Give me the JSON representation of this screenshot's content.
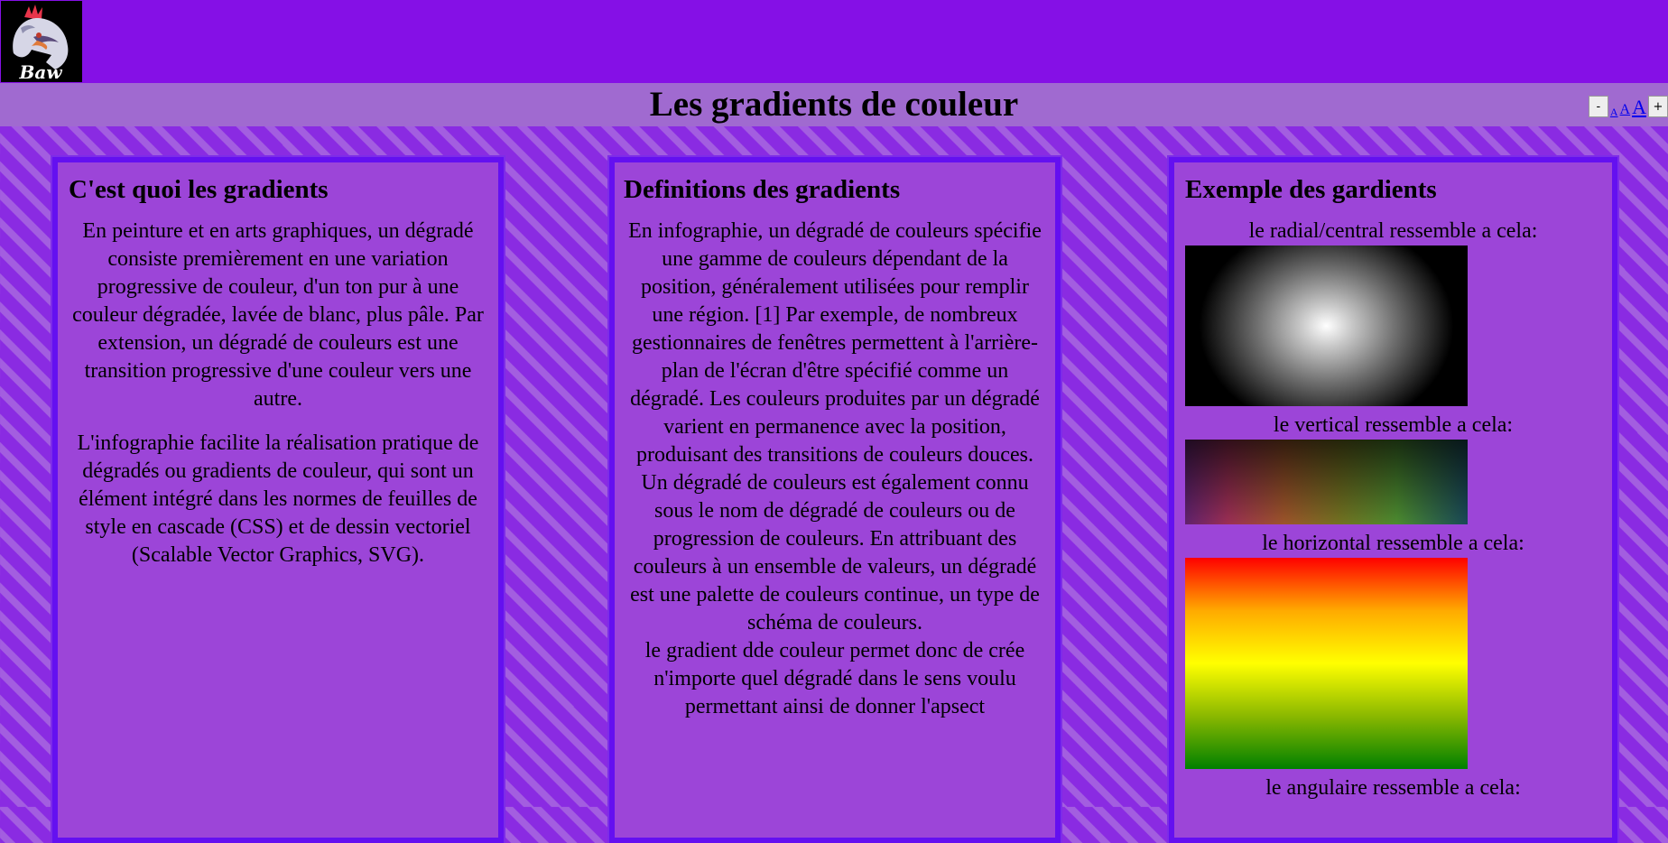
{
  "header": {
    "logo_text": "Baw",
    "title": "Les gradients de couleur",
    "font_controls": {
      "decrease": "-",
      "small_a": "A",
      "medium_a": "A",
      "large_a": "A",
      "increase": "+"
    }
  },
  "columns": [
    {
      "heading": "C'est quoi les gradients",
      "paragraphs": [
        "En peinture et en arts graphiques, un dégradé consiste premièrement en une variation progressive de couleur, d'un ton pur à une couleur dégradée, lavée de blanc, plus pâle. Par extension, un dégradé de couleurs est une transition progressive d'une couleur vers une autre.",
        "L'infographie facilite la réalisation pratique de dégradés ou gradients de couleur, qui sont un élément intégré dans les normes de feuilles de style en cascade (CSS) et de dessin vectoriel (Scalable Vector Graphics, SVG)."
      ]
    },
    {
      "heading": "Definitions des gradients",
      "paragraphs": [
        "En infographie, un dégradé de couleurs spécifie une gamme de couleurs dépendant de la position, généralement utilisées pour remplir une région. [1] Par exemple, de nombreux gestionnaires de fenêtres permettent à l'arrière-plan de l'écran d'être spécifié comme un dégradé. Les couleurs produites par un dégradé varient en permanence avec la position, produisant des transitions de couleurs douces.",
        "Un dégradé de couleurs est également connu sous le nom de dégradé de couleurs ou de progression de couleurs. En attribuant des couleurs à un ensemble de valeurs, un dégradé est une palette de couleurs continue, un type de schéma de couleurs.",
        "le gradient dde couleur permet donc de crée n'importe quel dégradé dans le sens voulu permettant ainsi de donner l'apsect"
      ]
    },
    {
      "heading": "Exemple des gardients",
      "examples": [
        {
          "label": "le radial/central ressemble a cela:"
        },
        {
          "label": "le vertical ressemble a cela:"
        },
        {
          "label": "le horizontal ressemble a cela:"
        },
        {
          "label": "le angulaire ressemble a cela:"
        }
      ]
    }
  ],
  "colors": {
    "page_bg": "#8a2be2",
    "stripe": "#a35ee0",
    "topbar": "#8510e6",
    "titlebar": "#a06ad0",
    "column_bg": "#9c45d8",
    "column_border": "#6410f0"
  }
}
